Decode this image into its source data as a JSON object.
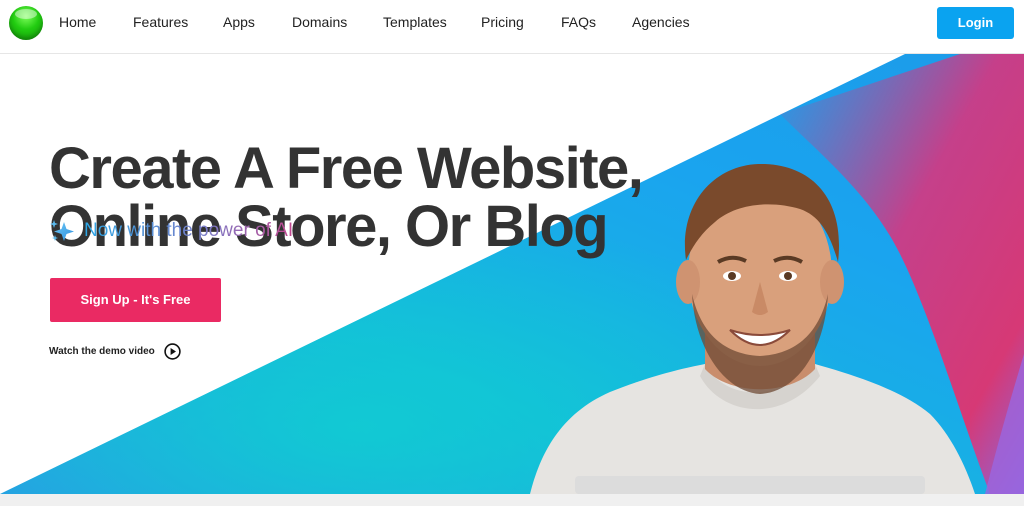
{
  "brand": {
    "logo_icon": "green-sphere-logo-icon"
  },
  "nav": {
    "items": [
      {
        "label": "Home"
      },
      {
        "label": "Features"
      },
      {
        "label": "Apps"
      },
      {
        "label": "Domains"
      },
      {
        "label": "Templates"
      },
      {
        "label": "Pricing"
      },
      {
        "label": "FAQs"
      },
      {
        "label": "Agencies"
      }
    ],
    "login_label": "Login"
  },
  "hero": {
    "headline_line1": "Create A Free Website,",
    "headline_line2": "Online Store, Or Blog",
    "ai_text": "Now with the power of AI",
    "signup_label": "Sign Up - It's Free",
    "demo_label": "Watch the demo video"
  },
  "colors": {
    "accent_blue": "#0aa3f0",
    "signup_pink": "#ea2a63",
    "headline_text": "#333333",
    "gradient_blue": "#1ea0ee",
    "gradient_cyan": "#14c2d8",
    "gradient_magenta": "#d23a86"
  }
}
